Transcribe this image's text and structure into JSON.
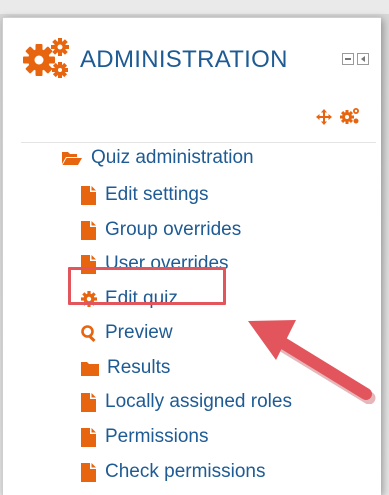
{
  "header": {
    "title": "ADMINISTRATION"
  },
  "tree": {
    "root": {
      "label": "Quiz administration"
    },
    "items": [
      {
        "label": "Edit settings",
        "icon": "file-icon"
      },
      {
        "label": "Group overrides",
        "icon": "file-icon"
      },
      {
        "label": "User overrides",
        "icon": "file-icon"
      },
      {
        "label": "Edit quiz",
        "icon": "gear-icon"
      },
      {
        "label": "Preview",
        "icon": "search-icon"
      },
      {
        "label": "Results",
        "icon": "folder-icon"
      },
      {
        "label": "Locally assigned roles",
        "icon": "file-icon"
      },
      {
        "label": "Permissions",
        "icon": "file-icon"
      },
      {
        "label": "Check permissions",
        "icon": "file-icon"
      }
    ]
  },
  "colors": {
    "accent_orange": "#e8650f",
    "link_blue": "#1e5b94",
    "highlight_red": "#e2555c"
  }
}
